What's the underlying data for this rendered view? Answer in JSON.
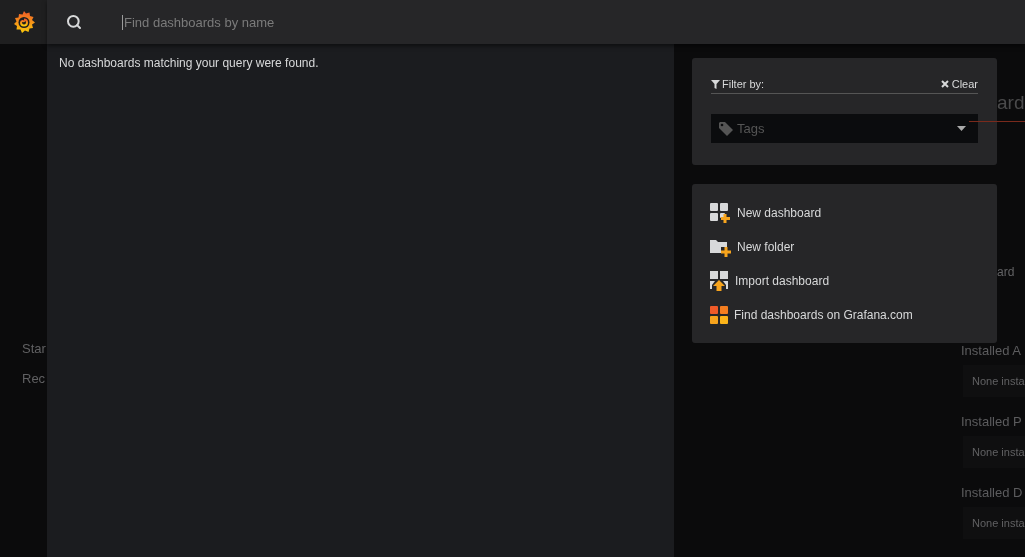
{
  "search": {
    "placeholder": "Find dashboards by name"
  },
  "results": {
    "message": "No dashboards matching your query were found."
  },
  "filter": {
    "title": "Filter by:",
    "clear": "Clear",
    "tags_placeholder": "Tags"
  },
  "actions": [
    {
      "kind": "new-dashboard",
      "label": "New dashboard"
    },
    {
      "kind": "new-folder",
      "label": "New folder"
    },
    {
      "kind": "import",
      "label": "Import dashboard"
    },
    {
      "kind": "grafana-com",
      "label": "Find dashboards on Grafana.com"
    }
  ],
  "background": {
    "left_items": [
      "Star",
      "Rec"
    ],
    "title_fragment": "ard",
    "link_fragment": "ard",
    "sections": [
      {
        "title": "Installed A",
        "empty": "None insta"
      },
      {
        "title": "Installed P",
        "empty": "None insta"
      },
      {
        "title": "Installed D",
        "empty": "None insta"
      }
    ]
  }
}
